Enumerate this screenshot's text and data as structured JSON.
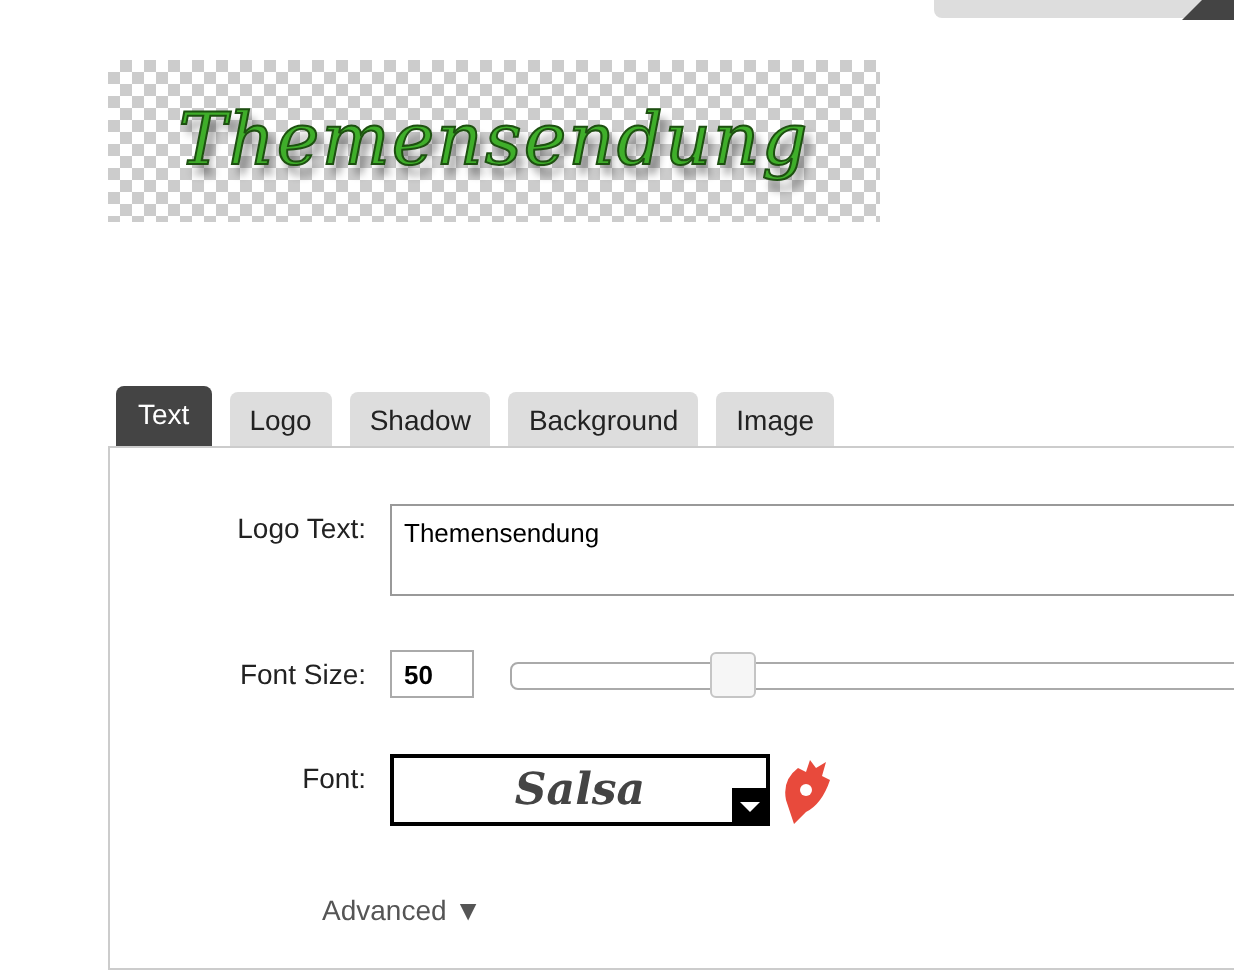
{
  "preview": {
    "text": "Themensendung"
  },
  "tabs": [
    {
      "label": "Text",
      "selected": true
    },
    {
      "label": "Logo",
      "selected": false
    },
    {
      "label": "Shadow",
      "selected": false
    },
    {
      "label": "Background",
      "selected": false
    },
    {
      "label": "Image",
      "selected": false
    }
  ],
  "logo_text": {
    "label": "Logo Text:",
    "value": "Themensendung"
  },
  "font_size": {
    "label": "Font Size:",
    "value": "50",
    "level": 0.24
  },
  "font": {
    "label": "Font:",
    "value": "Salsa"
  },
  "advanced": {
    "label": "Advanced",
    "arrow": "▼"
  }
}
